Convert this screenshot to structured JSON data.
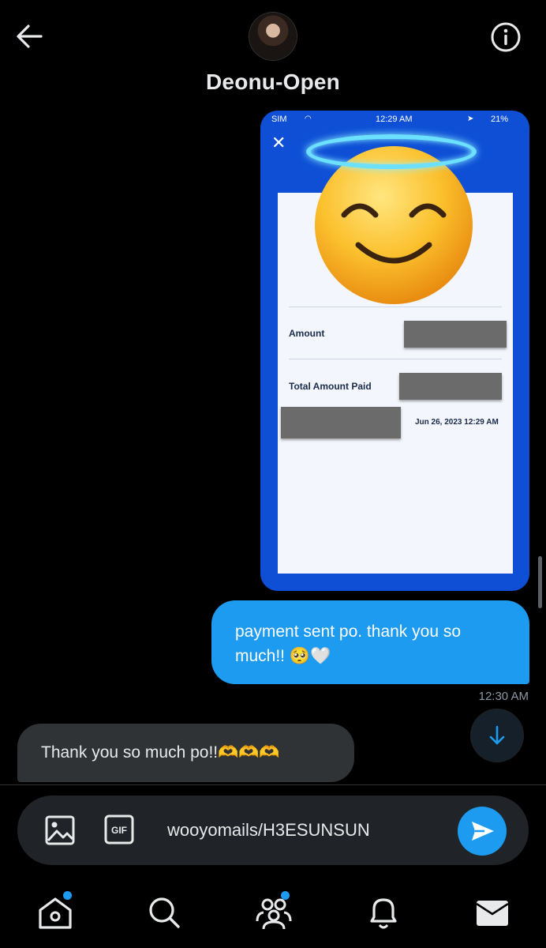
{
  "header": {
    "contact_name": "Deonu-Open",
    "back_icon": "arrow-left-icon",
    "info_icon": "info-circle-icon"
  },
  "image_message": {
    "status_bar": {
      "carrier": "SIM",
      "time": "12:29 AM",
      "battery": "21%"
    },
    "receipt": {
      "amount_label": "Amount",
      "total_label": "Total Amount Paid",
      "date": "Jun 26, 2023 12:29 AM"
    },
    "overlay_emoji": "smiling-face-with-halo"
  },
  "messages": {
    "sent": {
      "text": "payment sent po. thank you so much!! 🥺🤍",
      "time": "12:30 AM"
    },
    "received": {
      "text": "Thank you so much po!!🫶🫶🫶"
    }
  },
  "composer": {
    "input_value": "wooyomails/H3ESUNSUN",
    "gif_label": "GIF"
  },
  "tabs": [
    {
      "name": "home",
      "has_badge": true
    },
    {
      "name": "search",
      "has_badge": false
    },
    {
      "name": "communities",
      "has_badge": true
    },
    {
      "name": "notifications",
      "has_badge": false
    },
    {
      "name": "messages",
      "has_badge": false
    }
  ],
  "colors": {
    "accent": "#1d9bf0",
    "background": "#000000",
    "bubble_received": "#2f3336"
  }
}
